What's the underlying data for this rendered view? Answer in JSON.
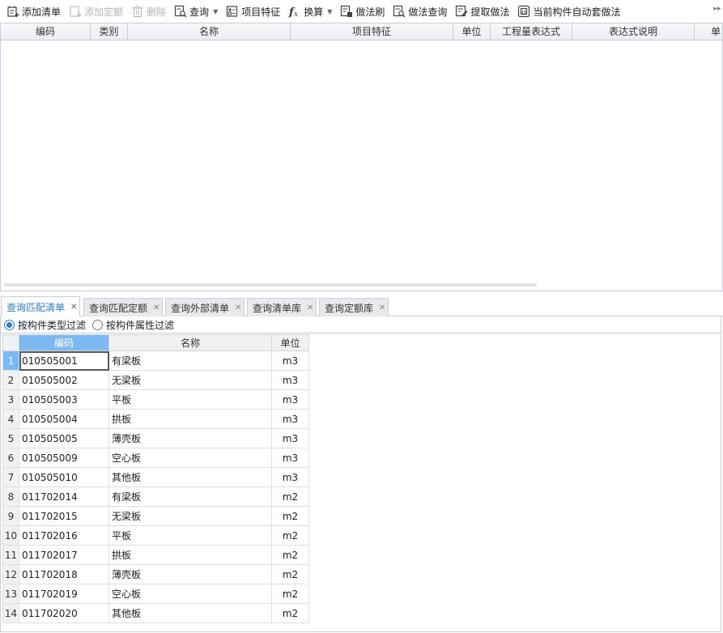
{
  "toolbar": {
    "items": [
      {
        "label": "添加清单",
        "icon": "add-list-icon",
        "enabled": true
      },
      {
        "label": "添加定额",
        "icon": "add-quota-icon",
        "enabled": false
      },
      {
        "label": "删除",
        "icon": "trash-icon",
        "enabled": false
      },
      {
        "label": "查询",
        "icon": "query-icon",
        "enabled": true,
        "dropdown": true
      },
      {
        "label": "项目特征",
        "icon": "feature-icon",
        "enabled": true
      },
      {
        "label": "换算",
        "icon": "fx-icon",
        "enabled": true,
        "dropdown": true
      },
      {
        "label": "做法刷",
        "icon": "brush-icon",
        "enabled": true
      },
      {
        "label": "做法查询",
        "icon": "method-query-icon",
        "enabled": true
      },
      {
        "label": "提取做法",
        "icon": "extract-icon",
        "enabled": true
      },
      {
        "label": "当前构件自动套做法",
        "icon": "auto-apply-icon",
        "enabled": true
      }
    ]
  },
  "top_grid": {
    "headers": [
      "编码",
      "类别",
      "名称",
      "项目特征",
      "单位",
      "工程量表达式",
      "表达式说明",
      "单"
    ]
  },
  "tabs": [
    {
      "label": "查询匹配清单",
      "active": true
    },
    {
      "label": "查询匹配定额",
      "active": false
    },
    {
      "label": "查询外部清单",
      "active": false
    },
    {
      "label": "查询清单库",
      "active": false
    },
    {
      "label": "查询定额库",
      "active": false
    }
  ],
  "filter": {
    "options": [
      {
        "label": "按构件类型过滤",
        "checked": true
      },
      {
        "label": "按构件属性过滤",
        "checked": false
      }
    ]
  },
  "result_grid": {
    "headers": [
      "编码",
      "名称",
      "单位"
    ],
    "rows": [
      [
        "1",
        "010505001",
        "有梁板",
        "m3"
      ],
      [
        "2",
        "010505002",
        "无梁板",
        "m3"
      ],
      [
        "3",
        "010505003",
        "平板",
        "m3"
      ],
      [
        "4",
        "010505004",
        "拱板",
        "m3"
      ],
      [
        "5",
        "010505005",
        "薄壳板",
        "m3"
      ],
      [
        "6",
        "010505009",
        "空心板",
        "m3"
      ],
      [
        "7",
        "010505010",
        "其他板",
        "m3"
      ],
      [
        "8",
        "011702014",
        "有梁板",
        "m2"
      ],
      [
        "9",
        "011702015",
        "无梁板",
        "m2"
      ],
      [
        "10",
        "011702016",
        "平板",
        "m2"
      ],
      [
        "11",
        "011702017",
        "拱板",
        "m2"
      ],
      [
        "12",
        "011702018",
        "薄壳板",
        "m2"
      ],
      [
        "13",
        "011702019",
        "空心板",
        "m2"
      ],
      [
        "14",
        "011702020",
        "其他板",
        "m2"
      ]
    ]
  },
  "colors": {
    "accent": "#2a7fd6",
    "selected_header": "#7cb8f2"
  }
}
